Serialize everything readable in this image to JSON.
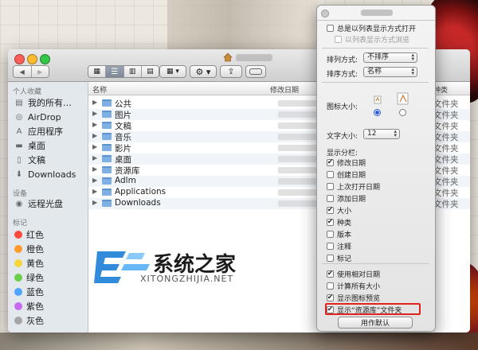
{
  "finder": {
    "sidebar": {
      "section_favorites": "个人收藏",
      "favorites": [
        {
          "label": "我的所有…",
          "icon": "all-files-icon"
        },
        {
          "label": "AirDrop",
          "icon": "airdrop-icon"
        },
        {
          "label": "应用程序",
          "icon": "applications-icon"
        },
        {
          "label": "桌面",
          "icon": "desktop-icon"
        },
        {
          "label": "文稿",
          "icon": "documents-icon"
        },
        {
          "label": "Downloads",
          "icon": "downloads-icon"
        }
      ],
      "section_devices": "设备",
      "devices": [
        {
          "label": "远程光盘",
          "icon": "disc-icon"
        }
      ],
      "section_tags": "标记",
      "tags": [
        {
          "label": "红色",
          "color": "#ff4a3d"
        },
        {
          "label": "橙色",
          "color": "#ff9a2b"
        },
        {
          "label": "黄色",
          "color": "#f5d63b"
        },
        {
          "label": "绿色",
          "color": "#6ad04a"
        },
        {
          "label": "蓝色",
          "color": "#4ea3ff"
        },
        {
          "label": "紫色",
          "color": "#c56cf0"
        },
        {
          "label": "灰色",
          "color": "#a5a5a5"
        }
      ]
    },
    "columns": {
      "name": "名称",
      "date": "修改日期",
      "kind": "种类"
    },
    "rows": [
      {
        "name": "公共",
        "kind": "文件夹"
      },
      {
        "name": "图片",
        "kind": "文件夹"
      },
      {
        "name": "文稿",
        "kind": "文件夹"
      },
      {
        "name": "音乐",
        "kind": "文件夹"
      },
      {
        "name": "影片",
        "kind": "文件夹"
      },
      {
        "name": "桌面",
        "kind": "文件夹"
      },
      {
        "name": "资源库",
        "kind": "文件夹"
      },
      {
        "name": "Adlm",
        "kind": "文件夹"
      },
      {
        "name": "Applications",
        "kind": "文件夹"
      },
      {
        "name": "Downloads",
        "kind": "文件夹"
      }
    ]
  },
  "watermark": {
    "title": "系统之家",
    "subtitle": "XITONGZHIJIA.NET"
  },
  "view_options": {
    "always_list": "总是以列表显示方式打开",
    "list_browse": "以列表显示方式浏览",
    "arrange_label": "排列方式:",
    "arrange_value": "不排序",
    "sort_label": "排序方式:",
    "sort_value": "名称",
    "icon_size_label": "图标大小:",
    "text_size_label": "文字大小:",
    "text_size_value": "12",
    "columns_label": "显示分栏:",
    "columns": [
      {
        "label": "修改日期",
        "checked": true
      },
      {
        "label": "创建日期",
        "checked": false
      },
      {
        "label": "上次打开日期",
        "checked": false
      },
      {
        "label": "添加日期",
        "checked": false
      },
      {
        "label": "大小",
        "checked": true
      },
      {
        "label": "种类",
        "checked": true
      },
      {
        "label": "版本",
        "checked": false
      },
      {
        "label": "注释",
        "checked": false
      },
      {
        "label": "标记",
        "checked": false
      }
    ],
    "options": [
      {
        "label": "使用相对日期",
        "checked": true
      },
      {
        "label": "计算所有大小",
        "checked": false
      },
      {
        "label": "显示图标预览",
        "checked": true
      },
      {
        "label": "显示“资源库”文件夹",
        "checked": true
      }
    ],
    "default_button": "用作默认"
  }
}
